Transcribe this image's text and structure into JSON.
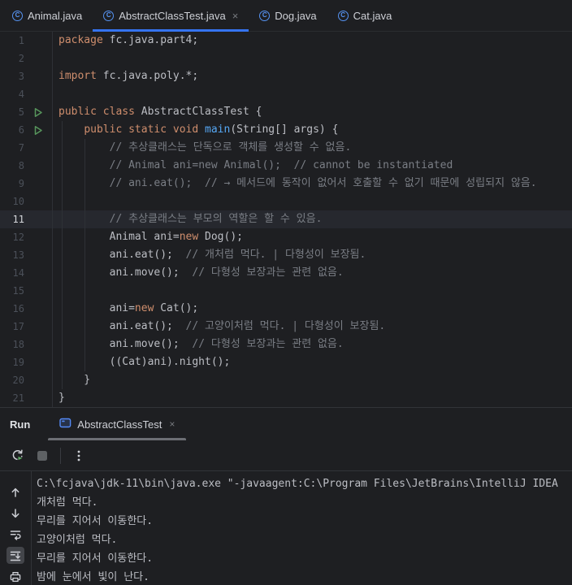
{
  "colors": {
    "background": "#1e1f22",
    "caret_line_background": "#26282e",
    "active_tab_underline": "#3574f0",
    "run_tab_underline": "#6c6e74",
    "keyword": "#cf8e6d",
    "default_text": "#bcbec4",
    "comment": "#7a7e85",
    "method_declaration": "#56a8f5",
    "line_number": "#4b5059",
    "run_arrow_green": "#57965c",
    "icon_gray": "#ced0d6",
    "class_icon_blue": "#5693f2"
  },
  "editor_tabbar": {
    "close_glyph": "×",
    "tabs": [
      {
        "label": "Animal.java",
        "icon": "class-icon",
        "active": false,
        "closable": false
      },
      {
        "label": "AbstractClassTest.java",
        "icon": "class-icon",
        "active": true,
        "closable": true
      },
      {
        "label": "Dog.java",
        "icon": "class-icon",
        "active": false,
        "closable": false
      },
      {
        "label": "Cat.java",
        "icon": "class-icon",
        "active": false,
        "closable": false
      }
    ]
  },
  "editor": {
    "lines": [
      {
        "num": "1",
        "segments": [
          {
            "text": "package",
            "color": "keyword"
          },
          {
            "text": " fc.java.part4;",
            "color": "default"
          }
        ]
      },
      {
        "num": "2",
        "segments": []
      },
      {
        "num": "3",
        "segments": [
          {
            "text": "import",
            "color": "keyword"
          },
          {
            "text": " fc.java.poly.*;",
            "color": "default"
          }
        ]
      },
      {
        "num": "4",
        "segments": []
      },
      {
        "num": "5",
        "run_arrow": true,
        "segments": [
          {
            "text": "public class",
            "color": "keyword"
          },
          {
            "text": " AbstractClassTest {",
            "color": "default"
          }
        ]
      },
      {
        "num": "6",
        "run_arrow": true,
        "segments": [
          {
            "text": "    ",
            "color": "default"
          },
          {
            "text": "public static void ",
            "color": "keyword"
          },
          {
            "text": "main",
            "color": "method"
          },
          {
            "text": "(String[] args) {",
            "color": "default"
          }
        ]
      },
      {
        "num": "7",
        "segments": [
          {
            "text": "        ",
            "color": "default"
          },
          {
            "text": "// 추상클래스는 단독으로 객체를 생성할 수 없음.",
            "color": "comment"
          }
        ]
      },
      {
        "num": "8",
        "segments": [
          {
            "text": "        ",
            "color": "default"
          },
          {
            "text": "// Animal ani=new Animal();  // cannot be instantiated",
            "color": "comment"
          }
        ]
      },
      {
        "num": "9",
        "segments": [
          {
            "text": "        ",
            "color": "default"
          },
          {
            "text": "// ani.eat();  // → 메서드에 동작이 없어서 호출할 수 없기 때문에 성립되지 않음.",
            "color": "comment"
          }
        ]
      },
      {
        "num": "10",
        "segments": []
      },
      {
        "num": "11",
        "caret_line": true,
        "segments": [
          {
            "text": "        ",
            "color": "default"
          },
          {
            "text": "// 추상클래스는 부모의 역할은 할 수 있음.",
            "color": "comment"
          }
        ]
      },
      {
        "num": "12",
        "segments": [
          {
            "text": "        Animal ani=",
            "color": "default"
          },
          {
            "text": "new",
            "color": "keyword"
          },
          {
            "text": " Dog();",
            "color": "default"
          }
        ]
      },
      {
        "num": "13",
        "segments": [
          {
            "text": "        ani.eat();  ",
            "color": "default"
          },
          {
            "text": "// 개처럼 먹다. | 다형성이 보장됨.",
            "color": "comment"
          }
        ]
      },
      {
        "num": "14",
        "segments": [
          {
            "text": "        ani.move();  ",
            "color": "default"
          },
          {
            "text": "// 다형성 보장과는 관련 없음.",
            "color": "comment"
          }
        ]
      },
      {
        "num": "15",
        "segments": []
      },
      {
        "num": "16",
        "segments": [
          {
            "text": "        ani=",
            "color": "default"
          },
          {
            "text": "new",
            "color": "keyword"
          },
          {
            "text": " Cat();",
            "color": "default"
          }
        ]
      },
      {
        "num": "17",
        "segments": [
          {
            "text": "        ani.eat();  ",
            "color": "default"
          },
          {
            "text": "// 고양이처럼 먹다. | 다형성이 보장됨.",
            "color": "comment"
          }
        ]
      },
      {
        "num": "18",
        "segments": [
          {
            "text": "        ani.move();  ",
            "color": "default"
          },
          {
            "text": "// 다형성 보장과는 관련 없음.",
            "color": "comment"
          }
        ]
      },
      {
        "num": "19",
        "segments": [
          {
            "text": "        ((Cat)ani).night();",
            "color": "default"
          }
        ]
      },
      {
        "num": "20",
        "segments": [
          {
            "text": "    }",
            "color": "default"
          }
        ]
      },
      {
        "num": "21",
        "segments": [
          {
            "text": "}",
            "color": "default"
          }
        ]
      }
    ]
  },
  "run_panel": {
    "title": "Run",
    "tab": {
      "label": "AbstractClassTest",
      "icon": "run-config-icon",
      "close_glyph": "×"
    },
    "toolbar_icons": [
      "rerun-icon",
      "stop-icon",
      "separator",
      "more-options-icon"
    ],
    "console_gutter_icons": [
      {
        "icon": "up-arrow-icon",
        "active": false
      },
      {
        "icon": "down-arrow-icon",
        "active": false
      },
      {
        "icon": "soft-wrap-icon",
        "active": false
      },
      {
        "icon": "scroll-to-end-icon",
        "active": true
      },
      {
        "icon": "print-icon",
        "active": false
      }
    ],
    "console_lines": [
      "C:\\fcjava\\jdk-11\\bin\\java.exe \"-javaagent:C:\\Program Files\\JetBrains\\IntelliJ IDEA",
      "개처럼 먹다.",
      "무리를 지어서 이동한다.",
      "고양이처럼 먹다.",
      "무리를 지어서 이동한다.",
      "밤에 눈에서 빛이 난다."
    ]
  }
}
